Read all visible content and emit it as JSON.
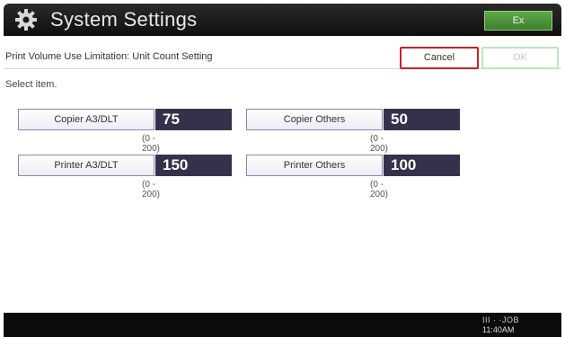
{
  "header": {
    "title": "System Settings",
    "exit_label": "Ex"
  },
  "subheader": {
    "title": "Print Volume Use Limitation: Unit Count Setting",
    "cancel_label": "Cancel",
    "ok_label": "OK"
  },
  "instruction": "Select item.",
  "settings": [
    {
      "label": "Copier A3/DLT",
      "value": "75",
      "range": "(0 - 200)"
    },
    {
      "label": "Copier Others",
      "value": "50",
      "range": "(0 - 200)"
    },
    {
      "label": "Printer A3/DLT",
      "value": "150",
      "range": "(0 - 200)"
    },
    {
      "label": "Printer Others",
      "value": "100",
      "range": "(0 - 200)"
    }
  ],
  "footer": {
    "status": "III  ·  ·JOB",
    "time": "11:40AM"
  },
  "colors": {
    "value_bg": "#34324b",
    "cancel_border": "#c82222",
    "ok_border": "#b9e7bd",
    "exit_green": "#4a9a3a"
  }
}
